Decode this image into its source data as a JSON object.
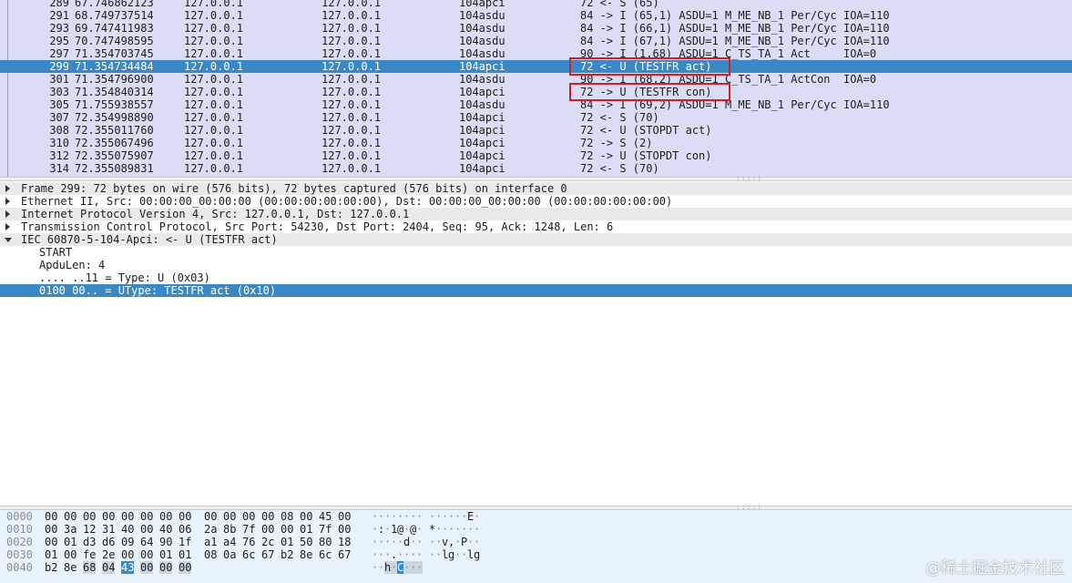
{
  "packet_list": {
    "rows": [
      {
        "no": "289",
        "time": "67.746862123",
        "src": "127.0.0.1",
        "dst": "127.0.0.1",
        "proto": "104apci",
        "info": "72 <- S (65)",
        "selected": false
      },
      {
        "no": "291",
        "time": "68.749737514",
        "src": "127.0.0.1",
        "dst": "127.0.0.1",
        "proto": "104asdu",
        "info": "84 -> I (65,1) ASDU=1 M_ME_NB_1 Per/Cyc IOA=110",
        "selected": false
      },
      {
        "no": "293",
        "time": "69.747411983",
        "src": "127.0.0.1",
        "dst": "127.0.0.1",
        "proto": "104asdu",
        "info": "84 -> I (66,1) ASDU=1 M_ME_NB_1 Per/Cyc IOA=110",
        "selected": false
      },
      {
        "no": "295",
        "time": "70.747498595",
        "src": "127.0.0.1",
        "dst": "127.0.0.1",
        "proto": "104asdu",
        "info": "84 -> I (67,1) ASDU=1 M_ME_NB_1 Per/Cyc IOA=110",
        "selected": false
      },
      {
        "no": "297",
        "time": "71.354703745",
        "src": "127.0.0.1",
        "dst": "127.0.0.1",
        "proto": "104asdu",
        "info": "90 -> I (1,68) ASDU=1 C_TS_TA_1 Act     IOA=0",
        "selected": false
      },
      {
        "no": "299",
        "time": "71.354734484",
        "src": "127.0.0.1",
        "dst": "127.0.0.1",
        "proto": "104apci",
        "info": "72 <- U (TESTFR act)",
        "selected": true
      },
      {
        "no": "301",
        "time": "71.354796900",
        "src": "127.0.0.1",
        "dst": "127.0.0.1",
        "proto": "104asdu",
        "info": "90 -> I (68,2) ASDU=1 C_TS_TA_1 ActCon  IOA=0",
        "selected": false
      },
      {
        "no": "303",
        "time": "71.354840314",
        "src": "127.0.0.1",
        "dst": "127.0.0.1",
        "proto": "104apci",
        "info": "72 -> U (TESTFR con)",
        "selected": false
      },
      {
        "no": "305",
        "time": "71.755938557",
        "src": "127.0.0.1",
        "dst": "127.0.0.1",
        "proto": "104asdu",
        "info": "84 -> I (69,2) ASDU=1 M_ME_NB_1 Per/Cyc IOA=110",
        "selected": false
      },
      {
        "no": "307",
        "time": "72.354998890",
        "src": "127.0.0.1",
        "dst": "127.0.0.1",
        "proto": "104apci",
        "info": "72 <- S (70)",
        "selected": false
      },
      {
        "no": "308",
        "time": "72.355011760",
        "src": "127.0.0.1",
        "dst": "127.0.0.1",
        "proto": "104apci",
        "info": "72 <- U (STOPDT act)",
        "selected": false
      },
      {
        "no": "310",
        "time": "72.355067496",
        "src": "127.0.0.1",
        "dst": "127.0.0.1",
        "proto": "104apci",
        "info": "72 -> S (2)",
        "selected": false
      },
      {
        "no": "312",
        "time": "72.355075907",
        "src": "127.0.0.1",
        "dst": "127.0.0.1",
        "proto": "104apci",
        "info": "72 -> U (STOPDT con)",
        "selected": false
      },
      {
        "no": "314",
        "time": "72.355089831",
        "src": "127.0.0.1",
        "dst": "127.0.0.1",
        "proto": "104apci",
        "info": "72 <- S (70)",
        "selected": false
      }
    ]
  },
  "details": {
    "rows": [
      {
        "text": "Frame 299: 72 bytes on wire (576 bits), 72 bytes captured (576 bits) on interface 0",
        "level": 0,
        "expander": "collapsed",
        "shaded": true,
        "selected": false
      },
      {
        "text": "Ethernet II, Src: 00:00:00_00:00:00 (00:00:00:00:00:00), Dst: 00:00:00_00:00:00 (00:00:00:00:00:00)",
        "level": 0,
        "expander": "collapsed",
        "shaded": false,
        "selected": false
      },
      {
        "text": "Internet Protocol Version 4, Src: 127.0.0.1, Dst: 127.0.0.1",
        "level": 0,
        "expander": "collapsed",
        "shaded": true,
        "selected": false
      },
      {
        "text": "Transmission Control Protocol, Src Port: 54230, Dst Port: 2404, Seq: 95, Ack: 1248, Len: 6",
        "level": 0,
        "expander": "collapsed",
        "shaded": false,
        "selected": false
      },
      {
        "text": "IEC 60870-5-104-Apci: <- U (TESTFR act)",
        "level": 0,
        "expander": "expanded",
        "shaded": true,
        "selected": false
      },
      {
        "text": "START",
        "level": 1,
        "expander": "none",
        "shaded": false,
        "selected": false
      },
      {
        "text": "ApduLen: 4",
        "level": 1,
        "expander": "none",
        "shaded": false,
        "selected": false
      },
      {
        "text": ".... ..11 = Type: U (0x03)",
        "level": 1,
        "expander": "none",
        "shaded": false,
        "selected": false
      },
      {
        "text": "0100 00.. = UType: TESTFR act (0x10)",
        "level": 1,
        "expander": "none",
        "shaded": false,
        "selected": true
      }
    ]
  },
  "hex": {
    "rows": [
      {
        "offset": "0000",
        "bytes": [
          "00",
          "00",
          "00",
          "00",
          "00",
          "00",
          "00",
          "00",
          "00",
          "00",
          "00",
          "00",
          "08",
          "00",
          "45",
          "00"
        ],
        "ascii": [
          "·",
          "·",
          "·",
          "·",
          "·",
          "·",
          "·",
          "·",
          "·",
          "·",
          "·",
          "·",
          "·",
          "·",
          "E",
          "·"
        ]
      },
      {
        "offset": "0010",
        "bytes": [
          "00",
          "3a",
          "12",
          "31",
          "40",
          "00",
          "40",
          "06",
          "2a",
          "8b",
          "7f",
          "00",
          "00",
          "01",
          "7f",
          "00"
        ],
        "ascii": [
          "·",
          ":",
          "·",
          "1",
          "@",
          "·",
          "@",
          "·",
          "*",
          "·",
          "·",
          "·",
          "·",
          "·",
          "·",
          "·"
        ]
      },
      {
        "offset": "0020",
        "bytes": [
          "00",
          "01",
          "d3",
          "d6",
          "09",
          "64",
          "90",
          "1f",
          "a1",
          "a4",
          "76",
          "2c",
          "01",
          "50",
          "80",
          "18"
        ],
        "ascii": [
          "·",
          "·",
          "·",
          "·",
          "·",
          "d",
          "·",
          "·",
          "·",
          "·",
          "v",
          ",",
          "·",
          "P",
          "·",
          "·"
        ]
      },
      {
        "offset": "0030",
        "bytes": [
          "01",
          "00",
          "fe",
          "2e",
          "00",
          "00",
          "01",
          "01",
          "08",
          "0a",
          "6c",
          "67",
          "b2",
          "8e",
          "6c",
          "67"
        ],
        "ascii": [
          "·",
          "·",
          "·",
          ".",
          "·",
          "·",
          "·",
          "·",
          "·",
          "·",
          "l",
          "g",
          "·",
          "·",
          "l",
          "g"
        ]
      },
      {
        "offset": "0040",
        "bytes": [
          "b2",
          "8e",
          "68",
          "04",
          "43",
          "00",
          "00",
          "00"
        ],
        "ascii": [
          "·",
          "·",
          "h",
          "·",
          "C",
          "·",
          "·",
          "·"
        ]
      }
    ],
    "selected_row": 4,
    "selected_byte": 4,
    "related_start": 2,
    "related_end": 7
  },
  "watermark": "@稀土掘金技术社区",
  "colors": {
    "selection": "#3a88c6",
    "packet_bg": "#dcdcf7",
    "highlight_box": "#d21f27",
    "hex_bg": "#e9f3fb"
  }
}
